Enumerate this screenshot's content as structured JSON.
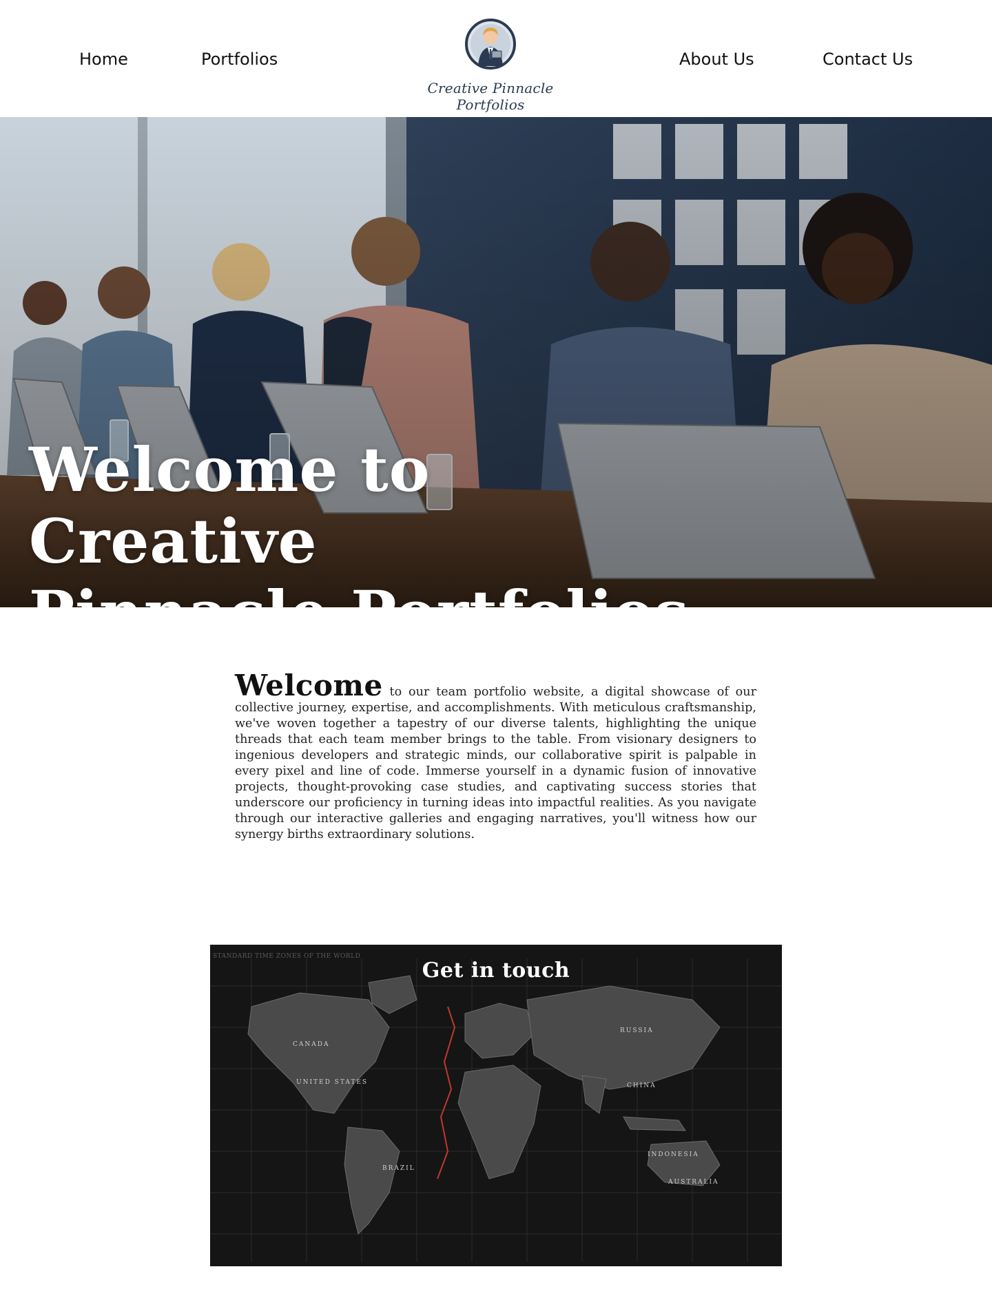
{
  "nav": {
    "home": "Home",
    "portfolios": "Portfolios",
    "about": "About Us",
    "contact": "Contact Us"
  },
  "logo": {
    "text": "Creative Pinnacle Portfolios"
  },
  "hero": {
    "title_line1": "Welcome to Creative",
    "title_line2": "Pinnacle Portfolios"
  },
  "welcome": {
    "lead": "Welcome",
    "body": " to our team portfolio website, a digital showcase of our collective journey, expertise, and accomplishments. With meticulous craftsmanship, we've woven together a tapestry of our diverse talents, highlighting the unique threads that each team member brings to the table. From visionary designers to ingenious developers and strategic minds, our collaborative spirit is palpable in every pixel and line of code. Immerse yourself in a dynamic fusion of innovative projects, thought-provoking case studies, and captivating success stories that underscore our proficiency in turning ideas into impactful realities. As you navigate through our interactive galleries and engaging narratives, you'll witness how our synergy births extraordinary solutions."
  },
  "contact": {
    "title": "Get in touch",
    "map_caption": "STANDARD TIME ZONES OF THE WORLD",
    "map_labels": {
      "canada": "CANADA",
      "united_states": "UNITED STATES",
      "russia": "RUSSIA",
      "china": "CHINA",
      "brazil": "BRAZIL",
      "indonesia": "INDONESIA",
      "australia": "AUSTRALIA"
    }
  }
}
